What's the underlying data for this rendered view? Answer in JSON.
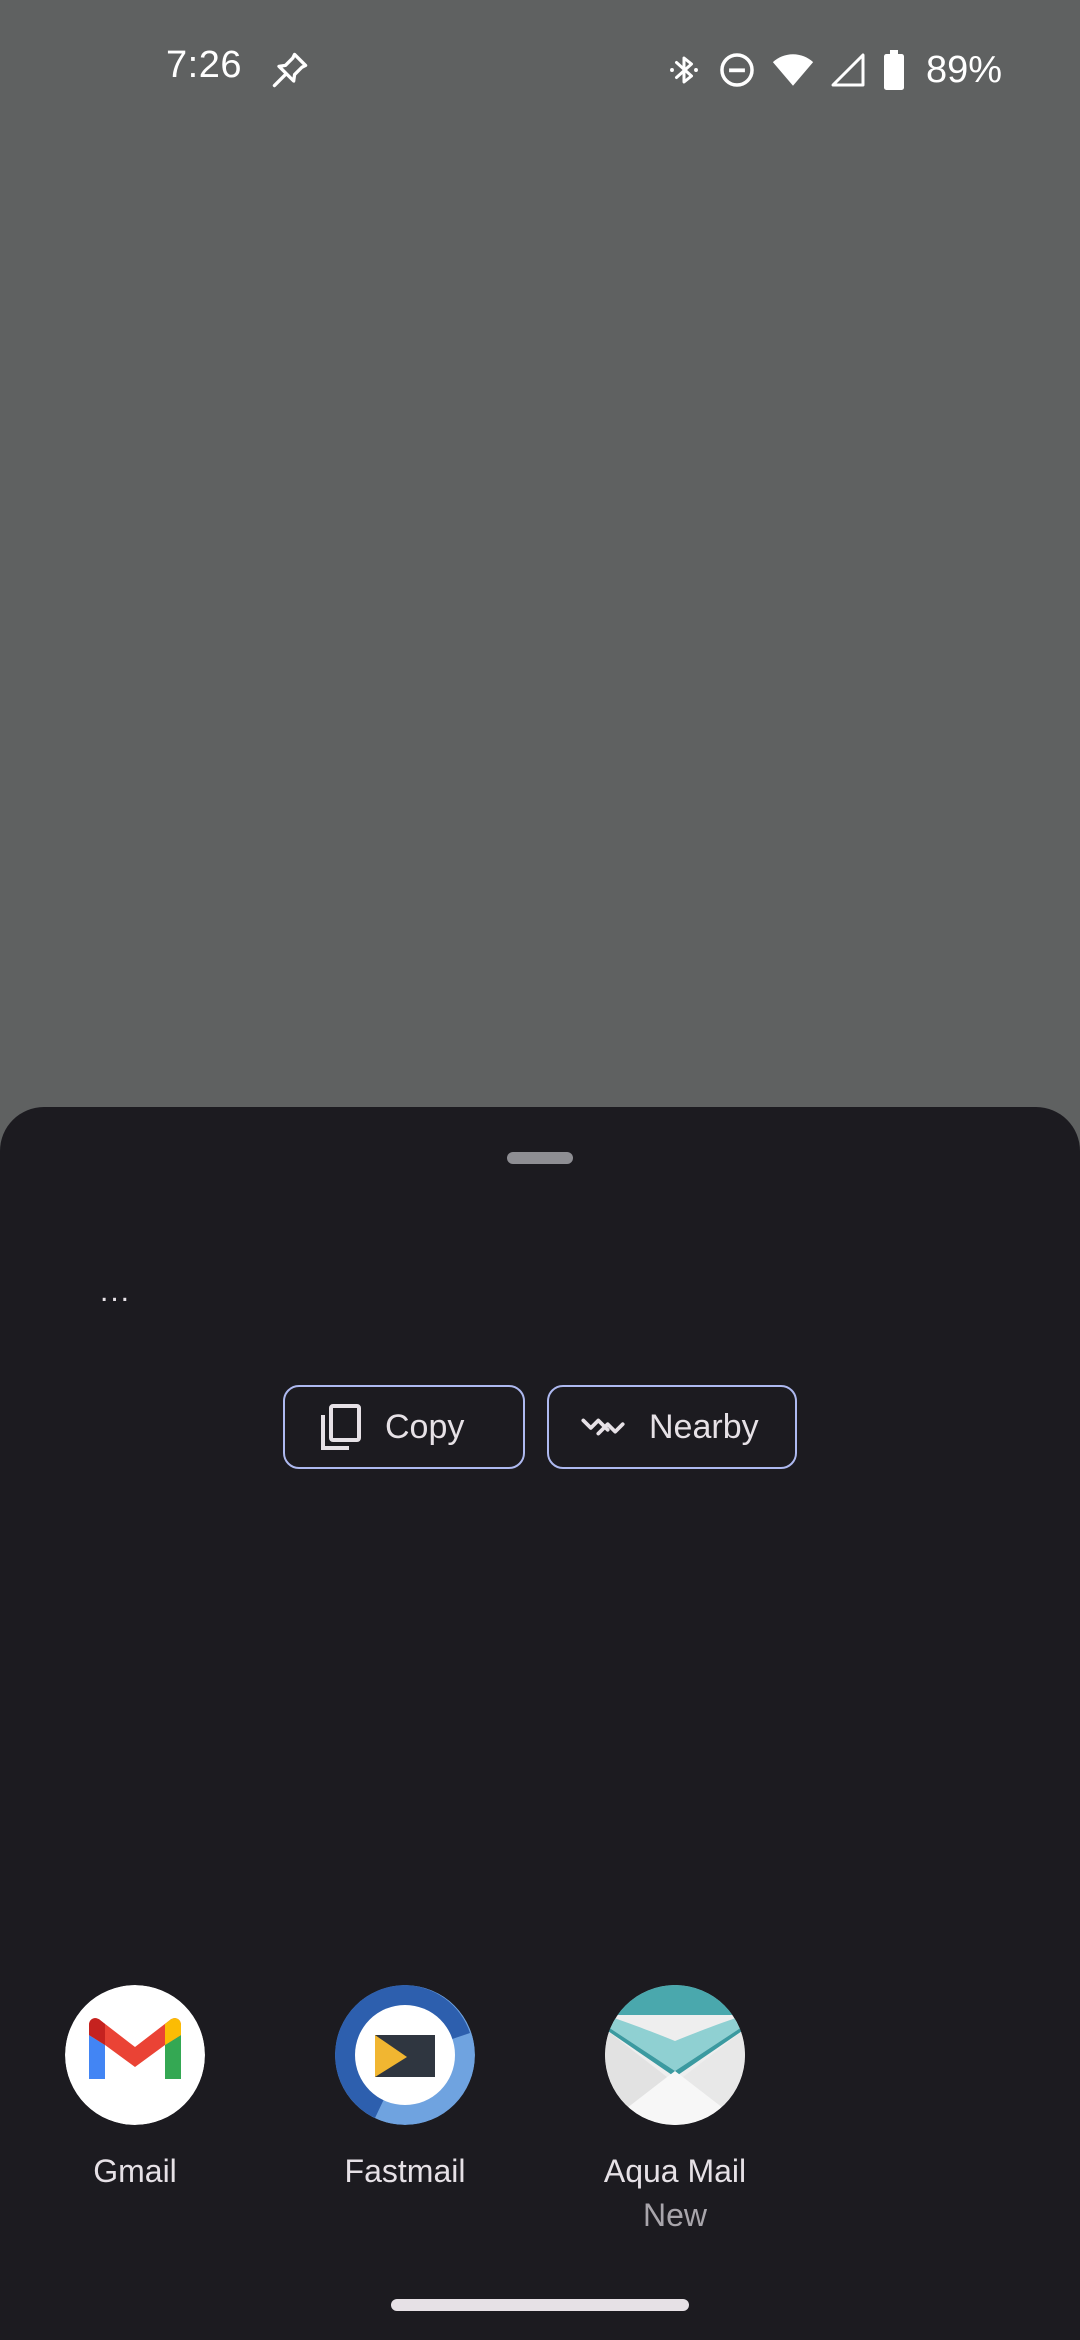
{
  "status_bar": {
    "time": "7:26",
    "battery_percent": "89%",
    "icons": [
      "pin-icon",
      "bluetooth-icon",
      "do-not-disturb-icon",
      "wifi-icon",
      "cellular-signal-icon",
      "battery-icon"
    ]
  },
  "share_sheet": {
    "preview_text": "...",
    "actions": [
      {
        "label": "Copy",
        "icon": "copy-icon"
      },
      {
        "label": "Nearby",
        "icon": "nearby-share-icon"
      }
    ],
    "apps": [
      {
        "label": "Gmail",
        "sublabel": ""
      },
      {
        "label": "Fastmail",
        "sublabel": ""
      },
      {
        "label": "Aqua Mail",
        "sublabel": "New"
      }
    ]
  },
  "colors": {
    "scrim": "#5f6161",
    "sheet_background": "#1c1b20",
    "chip_border": "#aeb9f0",
    "text_primary": "#e6e1e6",
    "text_secondary": "#a8a5ab"
  }
}
